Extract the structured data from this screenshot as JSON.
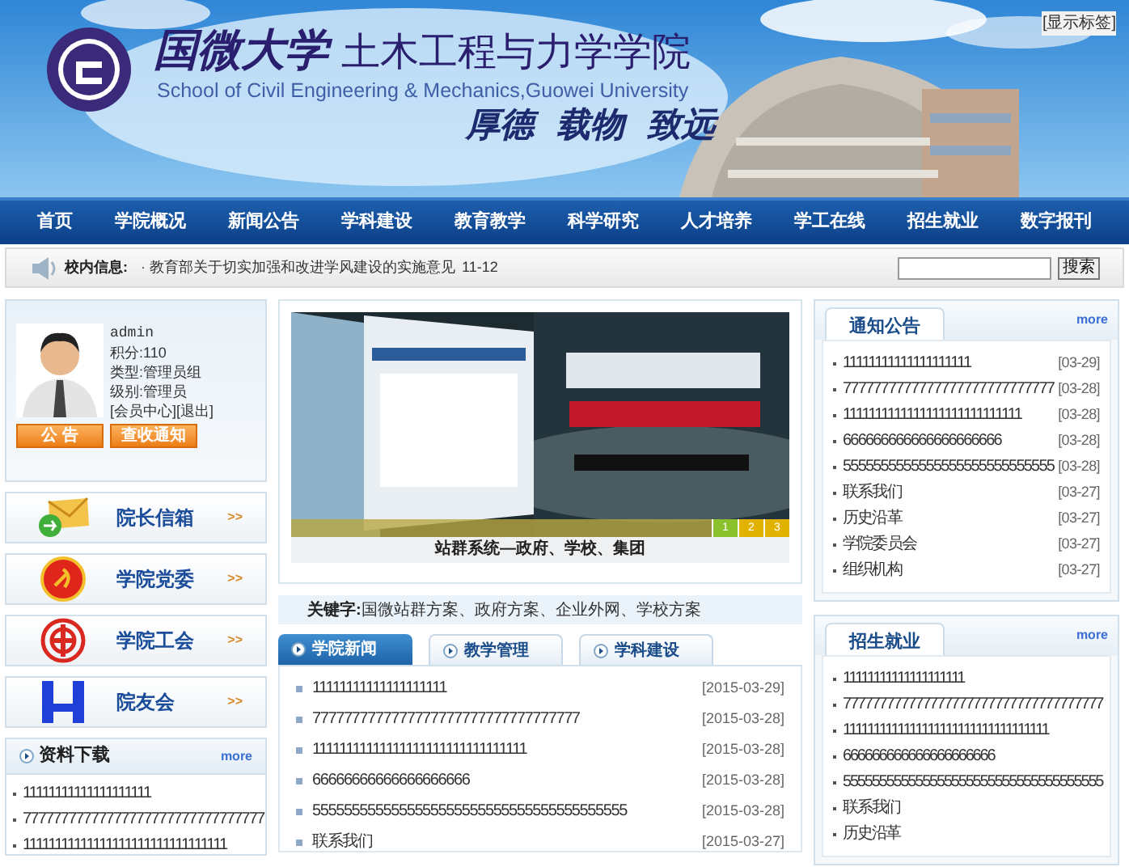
{
  "header": {
    "toggle_link": "[显示标签]",
    "university": "国微大学",
    "college": "土木工程与力学学院",
    "english": "School of Civil Engineering & Mechanics,Guowei University",
    "motto": [
      "厚德",
      "载物",
      "致远"
    ]
  },
  "nav": [
    {
      "label": "首页"
    },
    {
      "label": "学院概况"
    },
    {
      "label": "新闻公告"
    },
    {
      "label": "学科建设"
    },
    {
      "label": "教育教学"
    },
    {
      "label": "科学研究"
    },
    {
      "label": "人才培养"
    },
    {
      "label": "学工在线"
    },
    {
      "label": "招生就业"
    },
    {
      "label": "数字报刊"
    }
  ],
  "info_bar": {
    "label": "校内信息:",
    "item": "· 教育部关于切实加强和改进学风建设的实施意见",
    "date": "11-12",
    "search_button": "搜索"
  },
  "user": {
    "name": "admin",
    "points": "积分:110",
    "type": "类型:管理员组",
    "level": "级别:管理员",
    "links": [
      "[会员中心]",
      "[退出]"
    ],
    "buttons": [
      "公 告",
      "查收通知"
    ]
  },
  "quick_links": [
    {
      "kind": "mail",
      "label": "院长信箱",
      "arrow": ">>"
    },
    {
      "kind": "party",
      "label": "学院党委",
      "arrow": ">>"
    },
    {
      "kind": "union",
      "label": "学院工会",
      "arrow": ">>"
    },
    {
      "kind": "alumni",
      "label": "院友会",
      "arrow": ">>"
    }
  ],
  "downloads": {
    "title": "资料下载",
    "more": "more",
    "items": [
      "11111111111111111111",
      "77777777777777777777777777777777",
      "11111111111111111111111111111111"
    ]
  },
  "slider": {
    "caption": "站群系统—政府、学校、集团",
    "pages": [
      {
        "label": "1",
        "selected": true
      },
      {
        "label": "2",
        "selected": false
      },
      {
        "label": "3",
        "selected": false
      }
    ]
  },
  "keywords": {
    "label": "关键字:",
    "text": "国微站群方案、政府方案、企业外网、学校方案"
  },
  "tabs": [
    {
      "label": "学院新闻",
      "selected": true
    },
    {
      "label": "教学管理",
      "selected": false
    },
    {
      "label": "学科建设",
      "selected": false
    }
  ],
  "news": [
    {
      "title": "11111111111111111111",
      "date": "[2015-03-29]"
    },
    {
      "title": "7777777777777777777777777777777777",
      "date": "[2015-03-28]"
    },
    {
      "title": "11111111111111111111111111111111",
      "date": "[2015-03-28]"
    },
    {
      "title": "66666666666666666666",
      "date": "[2015-03-28]"
    },
    {
      "title": "5555555555555555555555555555555555555555",
      "date": "[2015-03-28]"
    },
    {
      "title": "联系我们",
      "date": "[2015-03-27]"
    }
  ],
  "notices": {
    "title": "通知公告",
    "more": "more",
    "items": [
      {
        "title": "11111111111111111111",
        "date": "[03-29]"
      },
      {
        "title": "7777777777777777777777777777",
        "date": "[03-28]"
      },
      {
        "title": "1111111111111111111111111111",
        "date": "[03-28]"
      },
      {
        "title": "666666666666666666666",
        "date": "[03-28]"
      },
      {
        "title": "5555555555555555555555555555",
        "date": "[03-28]"
      },
      {
        "title": "联系我们",
        "date": "[03-27]"
      },
      {
        "title": "历史沿革",
        "date": "[03-27]"
      },
      {
        "title": "学院委员会",
        "date": "[03-27]"
      },
      {
        "title": "组织机构",
        "date": "[03-27]"
      }
    ]
  },
  "recruit": {
    "title": "招生就业",
    "more": "more",
    "items": [
      "11111111111111111111",
      "777777777777777777777777777777777777",
      "1111111111111111111111111111111111",
      "666666666666666666666",
      "555555555555555555555555555555555555",
      "联系我们",
      "历史沿革"
    ]
  }
}
